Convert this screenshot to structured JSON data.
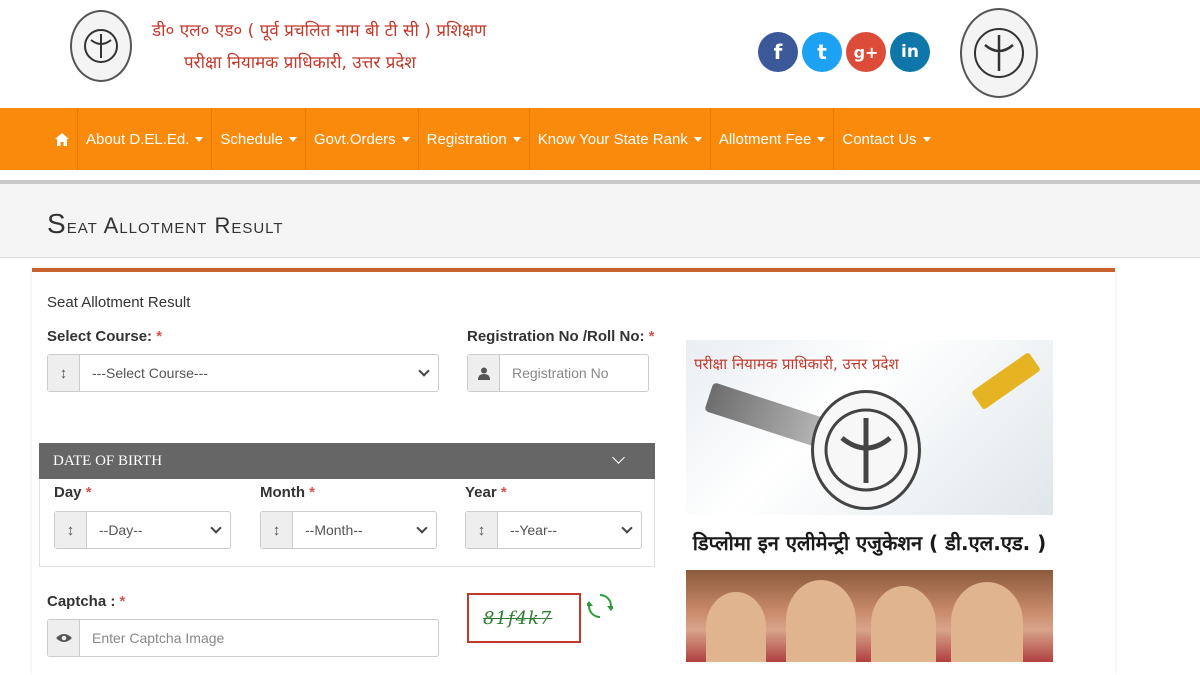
{
  "header": {
    "title_hindi": "डी० एल० एड० ( पूर्व प्रचलित नाम बी टी सी ) प्रशिक्षण",
    "subtitle_hindi": "परीक्षा नियामक प्राधिकारी, उत्तर प्रदेश",
    "social": {
      "facebook": "f",
      "twitter": "t",
      "googleplus": "g+",
      "linkedin": "in"
    }
  },
  "nav": {
    "items": [
      "About D.EL.Ed.",
      "Schedule",
      "Govt.Orders",
      "Registration",
      "Know Your State Rank",
      "Allotment Fee",
      "Contact Us"
    ]
  },
  "page": {
    "title": "Seat Allotment Result"
  },
  "form": {
    "caption": "Seat Allotment Result",
    "course_label": "Select Course:",
    "course_value": "---Select Course---",
    "regno_label": "Registration No /Roll No:",
    "regno_placeholder": "Registration No",
    "dob_header": "DATE OF BIRTH",
    "day_label": "Day",
    "day_value": "--Day--",
    "month_label": "Month",
    "month_value": "--Month--",
    "year_label": "Year",
    "year_value": "--Year--",
    "captcha_label": "Captcha :",
    "captcha_placeholder": "Enter Captcha Image",
    "captcha_text": "81f4k7",
    "required_mark": "*"
  },
  "banner": {
    "hindi_top": "परीक्षा नियामक प्राधिकारी, उत्तर प्रदेश",
    "hindi_strip": "डिप्लोमा इन एलीमेन्ट्री एजुकेशन ( डी.एल.एड. )"
  },
  "colors": {
    "nav": "#f98a0b",
    "accent": "#c6622e",
    "required": "#d9534f"
  }
}
